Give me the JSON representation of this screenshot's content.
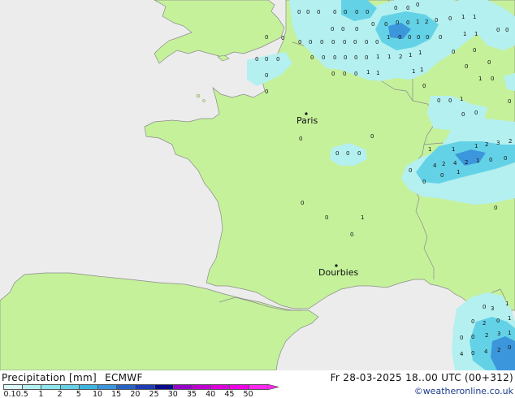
{
  "map": {
    "cities": [
      {
        "name": "Paris"
      },
      {
        "name": "Dourbies"
      }
    ],
    "colors": {
      "sea": "#ececec",
      "land": "#c5f19b",
      "border": "#8a8a8a",
      "precip_light": "#b4f0f0",
      "precip_mid": "#64d2e6",
      "precip_heavy": "#3c96dc"
    },
    "precip_values_visible": [
      "0",
      "1",
      "2",
      "3",
      "4"
    ]
  },
  "legend": {
    "title": "Precipitation [mm]",
    "model": "ECMWF",
    "ticks": [
      "0.1",
      "0.5",
      "1",
      "2",
      "5",
      "10",
      "15",
      "20",
      "25",
      "30",
      "35",
      "40",
      "45",
      "50"
    ],
    "colors": [
      "#dcf8fa",
      "#b4f0f0",
      "#8ce6ec",
      "#64d2e6",
      "#3cb4e0",
      "#3c96dc",
      "#2864c8",
      "#1e3cb4",
      "#0a0a8c",
      "#9600c8",
      "#be00d2",
      "#dc00dc",
      "#f000e6",
      "#ff28f0"
    ]
  },
  "header": {
    "datetime": "Fr 28-03-2025 18..00 UTC (00+312)",
    "credit": "©weatheronline.co.uk"
  }
}
